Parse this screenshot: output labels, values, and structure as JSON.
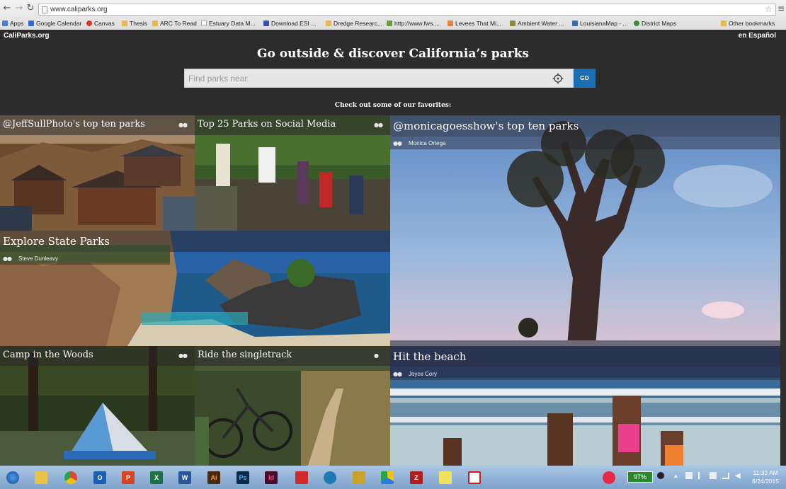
{
  "browser": {
    "url": "www.caliparks.org",
    "back_icon": "back-arrow-icon",
    "forward_icon": "forward-arrow-icon",
    "reload_icon": "reload-icon",
    "bookmarks": [
      {
        "label": "Apps",
        "color": "#4a7fd4"
      },
      {
        "label": "Google Calendar",
        "color": "#2a6ad4"
      },
      {
        "label": "Canvas",
        "color": "#d43a2a"
      },
      {
        "label": "Thesis",
        "color": "#e8b94a"
      },
      {
        "label": "ARC To Read",
        "color": "#e8b94a"
      },
      {
        "label": "Estuary Data M...",
        "color": "#cfcfcf"
      },
      {
        "label": "Download ESI ...",
        "color": "#3a4fb0"
      },
      {
        "label": "Dredge Researc...",
        "color": "#e8b94a"
      },
      {
        "label": "http://www.fws....",
        "color": "#6a9a3a"
      },
      {
        "label": "Levees That Mi...",
        "color": "#e8803a"
      },
      {
        "label": "Ambient Water ...",
        "color": "#8a8a3a"
      },
      {
        "label": "LouisianaMap - ...",
        "color": "#3a6ab0"
      },
      {
        "label": "District Maps",
        "color": "#3a8a3a"
      }
    ],
    "other_bookmarks": "Other bookmarks"
  },
  "site": {
    "logo": "CaliParks.org",
    "lang_link": "en Español",
    "headline": "Go outside & discover California’s parks",
    "search_placeholder": "Find parks near",
    "go_label": "GO",
    "favorites_heading": "Check out some of our favorites:"
  },
  "tiles": [
    {
      "title": "@JeffSullPhoto's top ten parks",
      "credit": ""
    },
    {
      "title": "Top 25 Parks on Social Media",
      "credit": ""
    },
    {
      "title": "@monicagoesshow's top ten parks",
      "credit": "Monica Ortega"
    },
    {
      "title": "Explore State Parks",
      "credit": "Steve Dunleavy"
    },
    {
      "title": "Camp in the Woods",
      "credit": ""
    },
    {
      "title": "Ride the singletrack",
      "credit": ""
    },
    {
      "title": "Hit the beach",
      "credit": "Joyce Cory"
    }
  ],
  "taskbar": {
    "apps": [
      {
        "icon": "windows-start-icon",
        "label": "",
        "color": "#2b6fc4"
      },
      {
        "icon": "folder-icon",
        "label": "",
        "color": "#e8c24a"
      },
      {
        "icon": "chrome-icon",
        "label": "",
        "color": "#e34234"
      },
      {
        "icon": "outlook-icon",
        "label": "O",
        "color": "#1b5fb0"
      },
      {
        "icon": "powerpoint-icon",
        "label": "P",
        "color": "#d24625"
      },
      {
        "icon": "excel-icon",
        "label": "X",
        "color": "#1e7145"
      },
      {
        "icon": "word-icon",
        "label": "W",
        "color": "#2b579a"
      },
      {
        "icon": "illustrator-icon",
        "label": "Ai",
        "color": "#4a2a0a"
      },
      {
        "icon": "photoshop-icon",
        "label": "Ps",
        "color": "#0a2a4a"
      },
      {
        "icon": "indesign-icon",
        "label": "Id",
        "color": "#4a0a2a"
      },
      {
        "icon": "shield-app-icon",
        "label": "",
        "color": "#d22a2a"
      },
      {
        "icon": "globe-search-icon",
        "label": "",
        "color": "#1e7ab0"
      },
      {
        "icon": "gis-app-icon",
        "label": "",
        "color": "#c8a22a"
      },
      {
        "icon": "google-drive-icon",
        "label": "",
        "color": "#2aa24a"
      },
      {
        "icon": "zotero-icon",
        "label": "Z",
        "color": "#b01e1e"
      },
      {
        "icon": "sticky-notes-icon",
        "label": "",
        "color": "#f0e060"
      },
      {
        "icon": "acrobat-icon",
        "label": "",
        "color": "#c81e1e"
      }
    ],
    "battery": "97%",
    "time": "11:32 AM",
    "date": "6/24/2015"
  }
}
